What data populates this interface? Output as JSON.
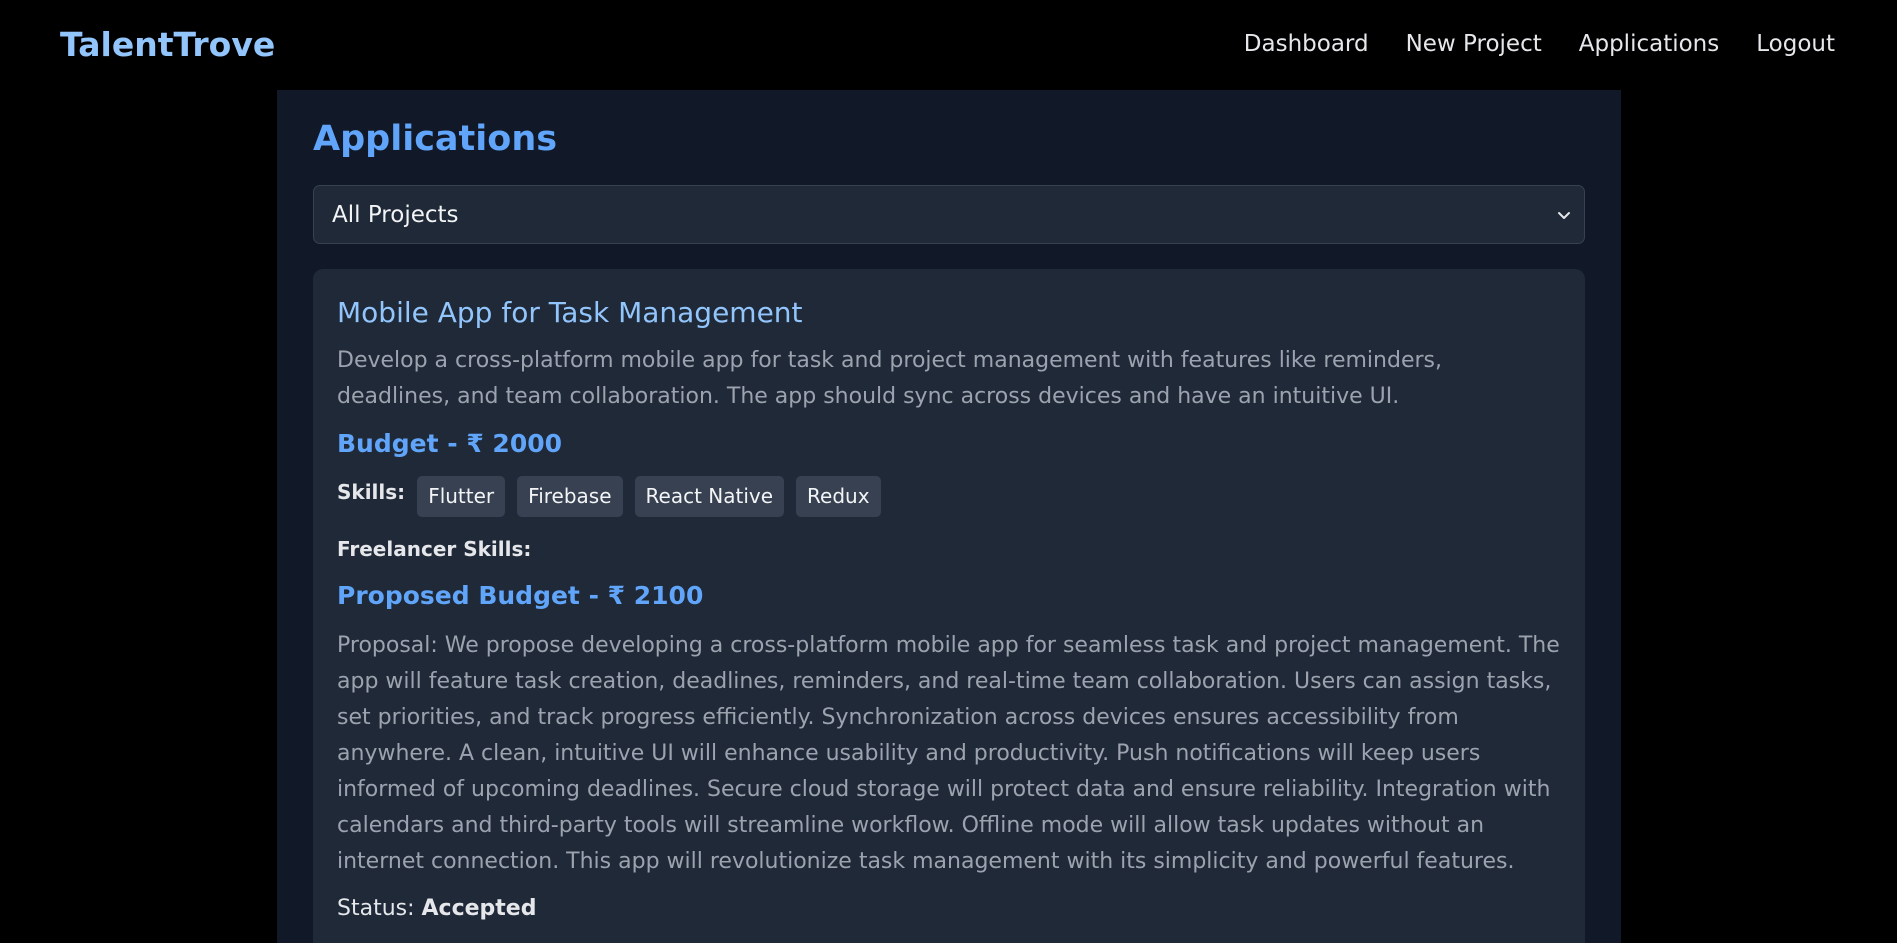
{
  "brand": "TalentTrove",
  "nav": {
    "items": [
      "Dashboard",
      "New Project",
      "Applications",
      "Logout"
    ]
  },
  "page": {
    "title": "Applications"
  },
  "filter": {
    "selected": "All Projects"
  },
  "application": {
    "title": "Mobile App for Task Management",
    "description": "Develop a cross-platform mobile app for task and project management with features like reminders, deadlines, and team collaboration. The app should sync across devices and have an intuitive UI.",
    "budget": "Budget - ₹ 2000",
    "skills_label": "Skills:",
    "skills": [
      "Flutter",
      "Firebase",
      "React Native",
      "Redux"
    ],
    "freelancer_skills_label": "Freelancer Skills:",
    "proposed_budget": "Proposed Budget - ₹ 2100",
    "proposal": "Proposal: We propose developing a cross-platform mobile app for seamless task and project management. The app will feature task creation, deadlines, reminders, and real-time team collaboration. Users can assign tasks, set priorities, and track progress efficiently. Synchronization across devices ensures accessibility from anywhere. A clean, intuitive UI will enhance usability and productivity. Push notifications will keep users informed of upcoming deadlines. Secure cloud storage will protect data and ensure reliability. Integration with calendars and third-party tools will streamline workflow. Offline mode will allow task updates without an internet connection. This app will revolutionize task management with its simplicity and powerful features.",
    "status_label": "Status:",
    "status_value": "Accepted"
  },
  "icons": {
    "dropdown": "chevron-down-icon"
  },
  "colors": {
    "background": "#000000",
    "panel": "#111827",
    "card": "#1f2937",
    "accent": "#60a5fa",
    "brand": "#93c5fd",
    "chip": "#374151"
  }
}
